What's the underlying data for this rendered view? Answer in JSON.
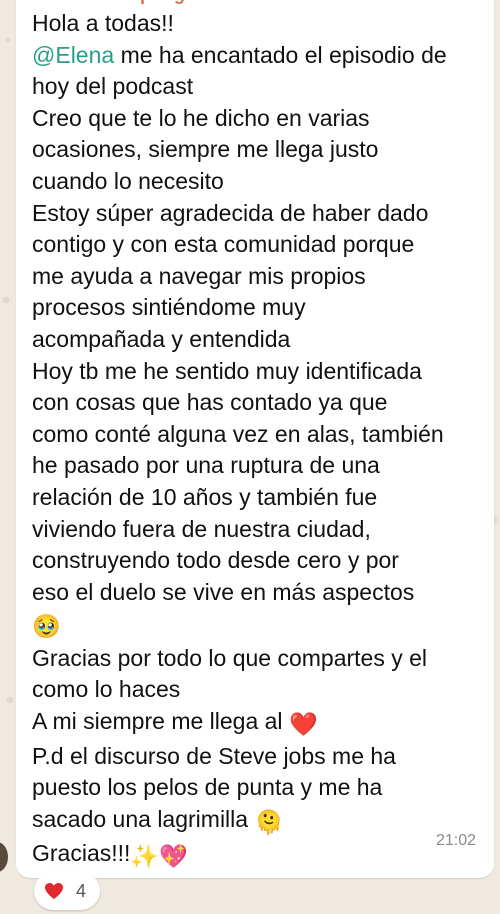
{
  "message": {
    "sender": "Flor Retiro Spring",
    "time": "21:02",
    "reaction": {
      "emoji": "heart-icon",
      "count": "4"
    },
    "lines": [
      "Hola a todas!!",
      "me ha encantado el episodio de",
      "hoy del podcast",
      "Creo que te lo he dicho en varias",
      "ocasiones, siempre me llega justo",
      "cuando lo necesito",
      "Estoy súper agradecida de haber dado",
      "contigo y con esta comunidad porque",
      "me ayuda a navegar mis propios",
      "procesos sintiéndome muy",
      "acompañada y entendida",
      "Hoy tb me he sentido muy identificada",
      "con cosas que has contado ya que",
      "como conté alguna vez en alas, también",
      "he pasado por una ruptura de una",
      "relación de 10 años y también fue",
      "viviendo fuera de nuestra ciudad,",
      "construyendo todo desde cero y por",
      "eso el duelo se vive en más aspectos",
      "Gracias por todo lo que compartes y el",
      "como lo haces",
      "A mi siempre me llega al",
      "P.d el discurso de Steve jobs me ha",
      "puesto los pelos de punta y me ha",
      "sacado una lagrimilla",
      "Gracias!!!"
    ],
    "mention": "@Elena",
    "emojis": {
      "pleading": "🥹",
      "heart": "❤️",
      "melting": "🫠",
      "sparkles": "✨",
      "sparkling_heart": "💖"
    }
  }
}
